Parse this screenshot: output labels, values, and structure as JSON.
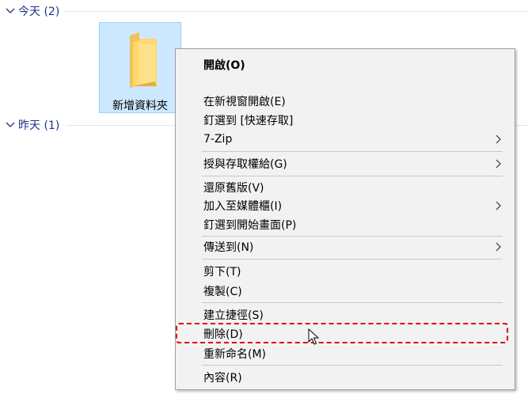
{
  "groups": {
    "today": "今天 (2)",
    "yesterday": "昨天 (1)"
  },
  "folder": {
    "name": "新增資料夾",
    "icon": "folder-icon",
    "selected": true
  },
  "menu": {
    "open": "開啟(O)",
    "open_new_window": "在新視窗開啟(E)",
    "pin_quick_access": "釘選到 [快速存取]",
    "seven_zip": "7-Zip",
    "give_access": "授與存取權給(G)",
    "restore_versions": "還原舊版(V)",
    "add_to_library": "加入至媒體櫃(I)",
    "pin_start": "釘選到開始畫面(P)",
    "send_to": "傳送到(N)",
    "cut": "剪下(T)",
    "copy": "複製(C)",
    "create_shortcut": "建立捷徑(S)",
    "delete": "刪除(D)",
    "rename": "重新命名(M)",
    "properties": "內容(R)"
  },
  "colors": {
    "group_header": "#1e3287",
    "selection_bg": "#cce8ff",
    "selection_border": "#99d1ff",
    "menu_bg": "#f2f2f2",
    "highlight": "#e00000"
  }
}
